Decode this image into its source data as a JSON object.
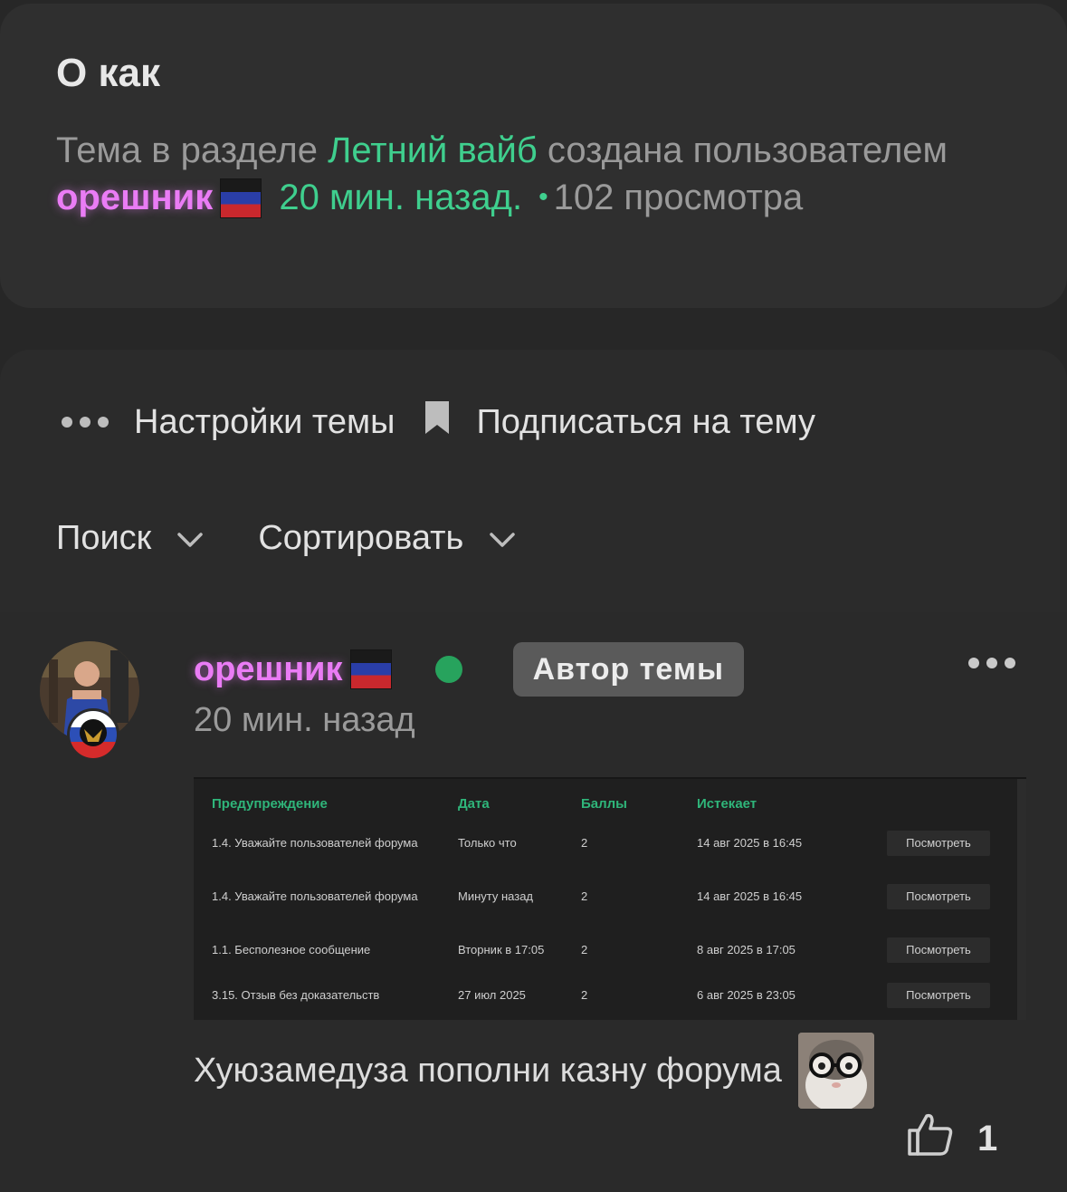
{
  "thread": {
    "title": "О как",
    "meta_prefix": "Тема в разделе ",
    "section": "Летний вайб",
    "meta_created": " создана пользователем ",
    "author": "орешник",
    "time": "20 мин. назад.",
    "views_bullet": "•",
    "views": "102 просмотра"
  },
  "toolbar": {
    "settings_label": "Настройки темы",
    "subscribe_label": "Подписаться на тему",
    "search_label": "Поиск",
    "sort_label": "Сортировать"
  },
  "post": {
    "author": "орешник",
    "badge": "Автор темы",
    "time": "20 мин. назад",
    "text": "Хуюзамедуза пополни казну форума",
    "likes": "1"
  },
  "warnings_table": {
    "headers": [
      "Предупреждение",
      "Дата",
      "Баллы",
      "Истекает",
      ""
    ],
    "rows": [
      {
        "reason": "1.4. Уважайте пользователей форума",
        "date": "Только что",
        "points": "2",
        "expires": "14 авг 2025 в 16:45",
        "action": "Посмотреть"
      },
      {
        "reason": "1.4. Уважайте пользователей форума",
        "date": "Минуту назад",
        "points": "2",
        "expires": "14 авг 2025 в 16:45",
        "action": "Посмотреть"
      },
      {
        "reason": "1.1. Бесполезное сообщение",
        "date": "Вторник в 17:05",
        "points": "2",
        "expires": "8 авг 2025 в 17:05",
        "action": "Посмотреть"
      },
      {
        "reason": "3.15. Отзыв без доказательств",
        "date": "27 июл 2025",
        "points": "2",
        "expires": "6 авг 2025 в 23:05",
        "action": "Посмотреть"
      }
    ]
  },
  "colors": {
    "accent_green": "#3fcf8e",
    "username_pink": "#ea7cf5",
    "online": "#27a35d"
  },
  "icons": {
    "settings": "more-dots-icon",
    "subscribe": "bookmark-icon",
    "dropdown": "chevron-down-icon",
    "like": "thumbs-up-icon",
    "post_menu": "more-dots-icon"
  }
}
